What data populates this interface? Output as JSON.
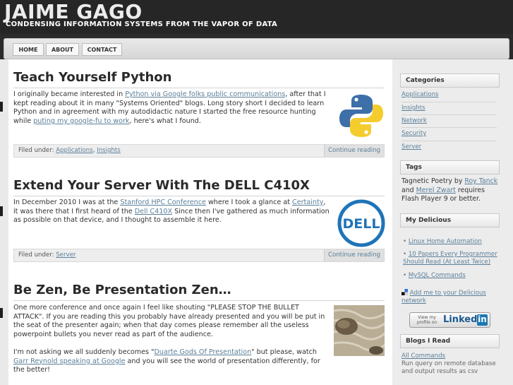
{
  "site": {
    "title": "JAIME GAGO",
    "tagline": "CONDENSING INFORMATION SYSTEMS FROM THE VAPOR OF DATA"
  },
  "nav": {
    "items": [
      "HOME",
      "ABOUT",
      "CONTACT"
    ]
  },
  "posts": [
    {
      "title": "Teach Yourself Python",
      "body": [
        {
          "t": "I originally became interested in "
        },
        {
          "t": "Python via Google folks public communications",
          "link": true
        },
        {
          "t": ", after that I kept reading about it in many \"Systems Oriented\" blogs. Long story short I decided to learn Python and in agreement with my autodidactic nature I started the free resource hunting while "
        },
        {
          "t": "puting my google-fu to work",
          "link": true
        },
        {
          "t": ", here's what I found."
        }
      ],
      "filed_label": "Filed under: ",
      "tags": [
        "Applications",
        "Insights"
      ],
      "continue_label": "Continue reading",
      "image_icon": "python-logo-icon"
    },
    {
      "title": "Extend Your Server With The DELL C410X",
      "body": [
        {
          "t": "In December 2010 I was at the "
        },
        {
          "t": "Stanford HPC Conference",
          "link": true
        },
        {
          "t": " where I took a glance at "
        },
        {
          "t": "Certainty",
          "link": true
        },
        {
          "t": ", it was there that I first heard of the "
        },
        {
          "t": "Dell C410X",
          "link": true
        },
        {
          "t": " Since then I've gathered as much information as possible on that device, and I thought to assemble it here."
        }
      ],
      "filed_label": "Filed under: ",
      "tags": [
        "Server"
      ],
      "continue_label": "Continue reading",
      "image_text": "DELL"
    },
    {
      "title": "Be Zen, Be Presentation Zen…",
      "body": [
        {
          "t": "One more conference and once again I feel like shouting \"PLEASE STOP THE BULLET ATTACK\". If you are reading this you probably have already presented and you will be put in the seat of the presenter again; when that day comes please remember all the useless powerpoint bullets you never read as part of the audience."
        }
      ],
      "body2": [
        {
          "t": "I'm not asking we all suddenly becomes \""
        },
        {
          "t": "Duarte Gods Of Presentation",
          "link": true
        },
        {
          "t": "\" but please, watch "
        },
        {
          "t": "Garr Reynold speaking at Google",
          "link": true
        },
        {
          "t": " and you will see the world of presentation differently, for the better!"
        }
      ],
      "image_icon": "zen-garden-photo"
    }
  ],
  "sidebar": {
    "categories_title": "Categories",
    "categories": [
      "Applications",
      "Insights",
      "Network",
      "Security",
      "Server"
    ],
    "tags_title": "Tags",
    "tags_text": [
      {
        "t": "Tagnetic Poetry by "
      },
      {
        "t": "Roy Tanck",
        "link": true
      },
      {
        "t": " and "
      },
      {
        "t": "Merel Zwart",
        "link": true
      },
      {
        "t": " requires Flash Player 9 or better."
      }
    ],
    "delicious_title": "My Delicious",
    "delicious_items": [
      "Linux Home Automation",
      "10 Papers Every Programmer Should Read (At Least Twice)",
      "MySQL Commands"
    ],
    "delicious_add": "Add me to your Delicious network",
    "linkedin_small": "View my profile on",
    "linkedin_brand": "Linked",
    "linkedin_in": "in",
    "blogs_title": "Blogs I Read",
    "blogs_link": "All Commands",
    "blogs_desc": "Run query on remote database and output results as csv"
  }
}
